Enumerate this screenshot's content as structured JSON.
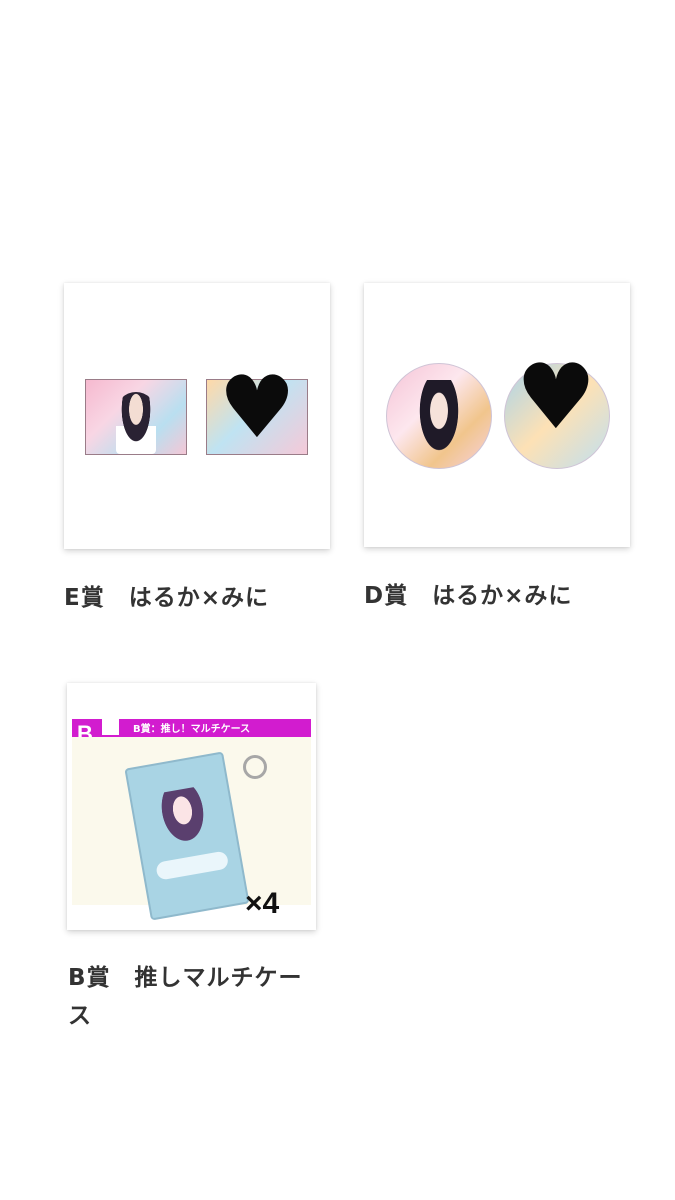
{
  "items": [
    {
      "caption": "E賞　はるか×みに"
    },
    {
      "caption": "D賞　はるか×みに"
    },
    {
      "caption_line1": "B賞　推しマルチケー",
      "caption_line2": "ス",
      "badge_letter": "B",
      "banner_text": "B賞：推し！マルチケース",
      "quantity": "×4"
    }
  ],
  "icons": [
    "black-heart-icon",
    "keyring-icon"
  ],
  "colors": {
    "accent_magenta": "#d21ccf",
    "case_blue": "#a9d4e4"
  }
}
